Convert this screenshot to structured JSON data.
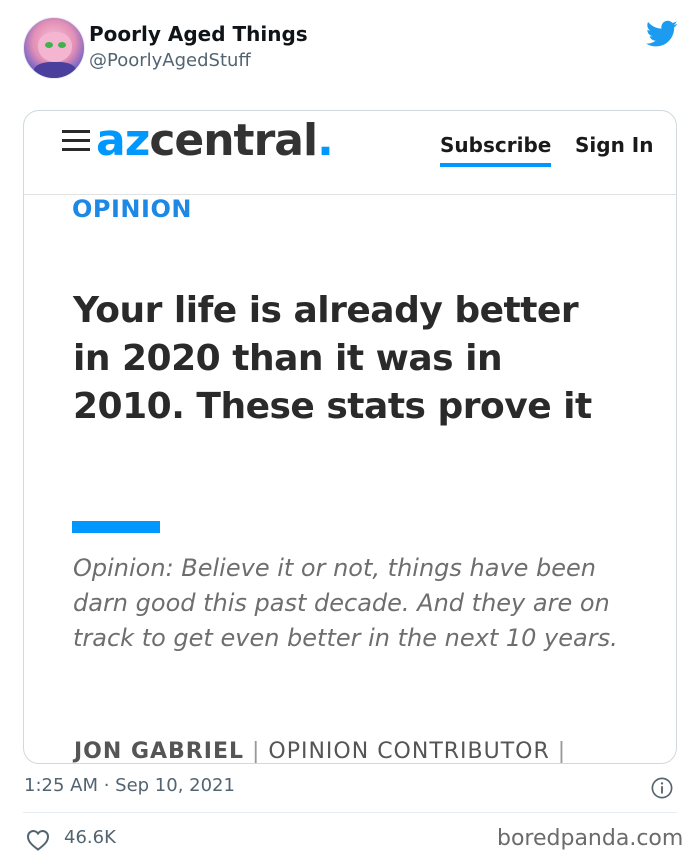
{
  "tweet": {
    "author_name": "Poorly Aged Things",
    "author_handle": "@PoorlyAgedStuff",
    "timestamp": "1:25 AM · Sep 10, 2021",
    "like_count": "46.6K"
  },
  "article": {
    "site_name_prefix": "az",
    "site_name_suffix": "central",
    "site_name_dot": ".",
    "subscribe_label": "Subscribe",
    "signin_label": "Sign In",
    "section": "OPINION",
    "headline": "Your life is already better in 2020 than it was in 2010. These stats prove it",
    "summary": "Opinion: Believe it or not, things have been darn good this past decade. And they are on track to get even better in the next 10 years.",
    "byline_author": "JON GABRIEL",
    "byline_separator": "|",
    "byline_role": "OPINION CONTRIBUTOR",
    "byline_trailing_separator": "|"
  },
  "watermark": "boredpanda.com",
  "colors": {
    "twitter_blue": "#1d9bf0",
    "azcentral_blue": "#0098fe",
    "section_blue": "#1e88e5"
  },
  "icons": {
    "brand": "twitter-bird-icon",
    "info": "info-icon",
    "like": "heart-icon",
    "menu": "hamburger-menu-icon"
  }
}
